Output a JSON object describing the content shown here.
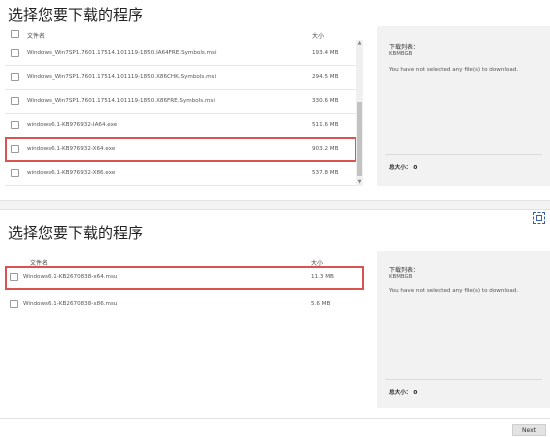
{
  "panel1": {
    "title": "选择您要下载的程序",
    "header": {
      "name": "文件名",
      "size": "大小"
    },
    "rows": [
      {
        "name": "Windows_Win7SP1.7601.17514.101119-1850.IA64FRE.Symbols.msi",
        "size": "193.4 MB"
      },
      {
        "name": "Windows_Win7SP1.7601.17514.101119-1850.X86CHK.Symbols.msi",
        "size": "294.5 MB"
      },
      {
        "name": "Windows_Win7SP1.7601.17514.101119-1850.X86FRE.Symbols.msi",
        "size": "330.6 MB"
      },
      {
        "name": "windows6.1-KB976932-IA64.exe",
        "size": "511.6 MB"
      },
      {
        "name": "windows6.1-KB976932-X64.exe",
        "size": "903.2 MB"
      },
      {
        "name": "windows6.1-KB976932-X86.exe",
        "size": "537.8 MB"
      }
    ],
    "right": {
      "label": "下载列表：",
      "sub": "KBMBGB",
      "message": "You have not selected any file(s) to download.",
      "total": "总大小： 0"
    }
  },
  "panel2": {
    "title": "选择您要下载的程序",
    "header": {
      "name": "文件名",
      "size": "大小"
    },
    "rows": [
      {
        "name": "Windows6.1-KB2670838-x64.msu",
        "size": "11.3 MB"
      },
      {
        "name": "Windows6.1-KB2670838-x86.msu",
        "size": "5.6 MB"
      }
    ],
    "right": {
      "label": "下载列表：",
      "sub": "KBMBGB",
      "message": "You have not selected any file(s) to download.",
      "total": "总大小： 0"
    },
    "next_label": "Next"
  },
  "colors": {
    "highlight": "#d9534f",
    "right_panel_bg": "#f2f2f2"
  }
}
